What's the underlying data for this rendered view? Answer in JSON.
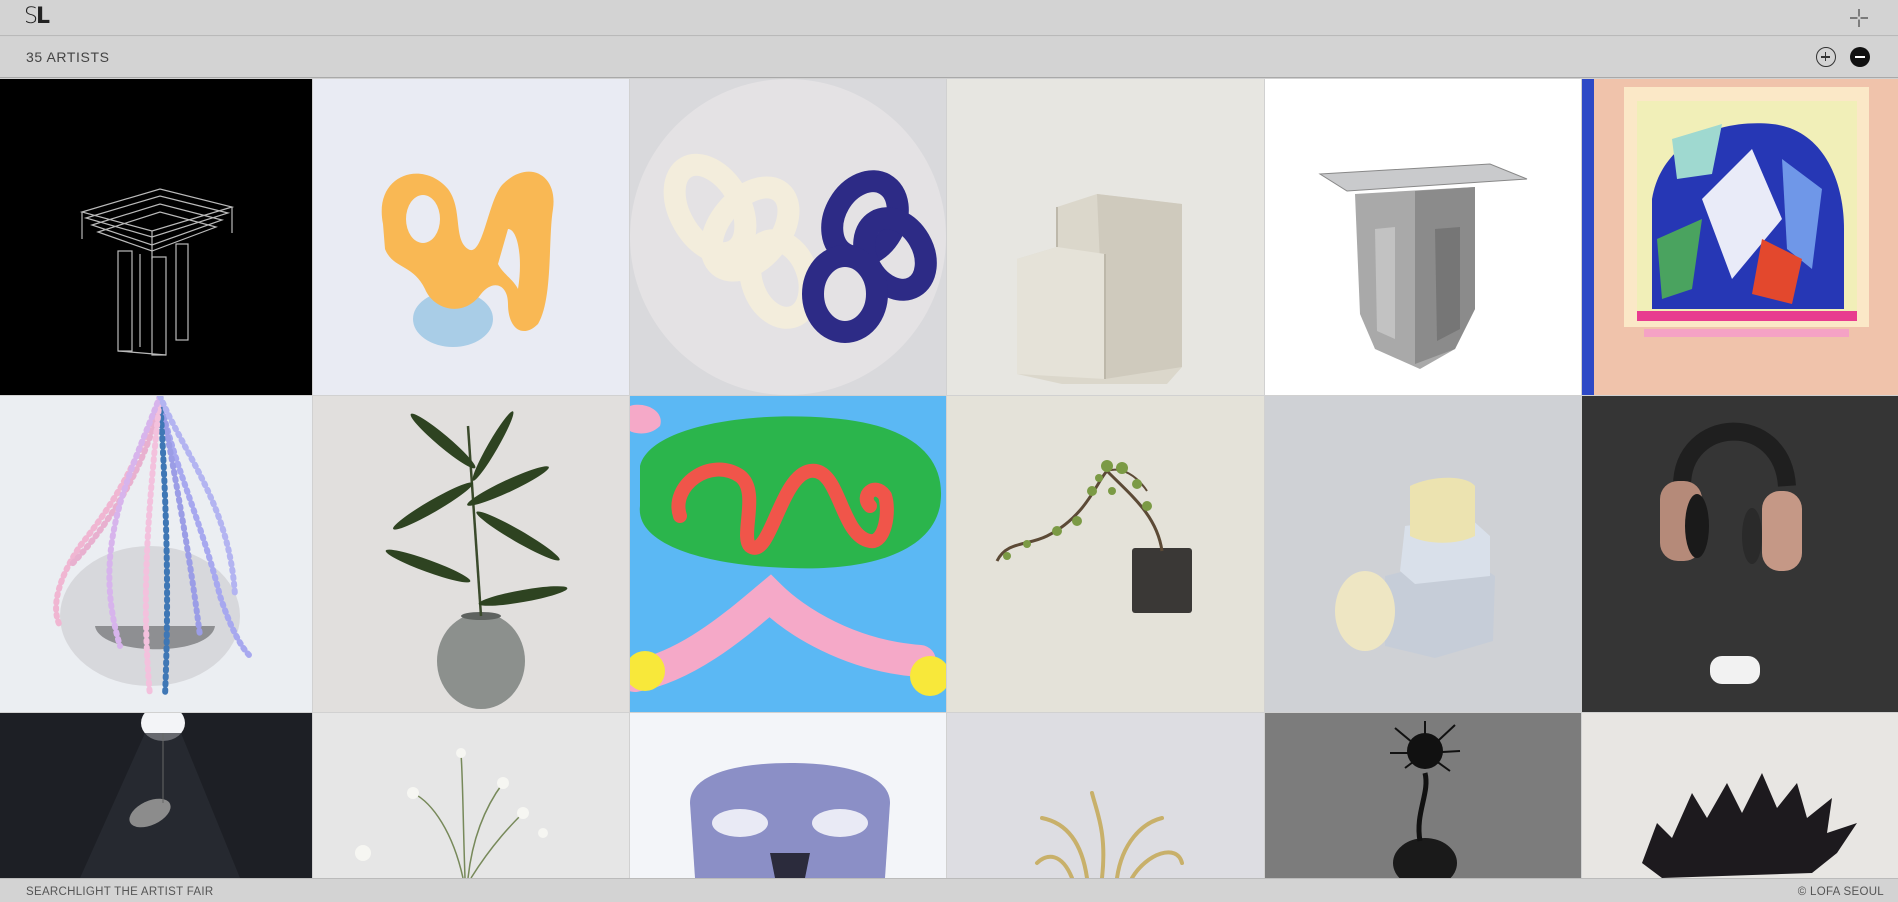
{
  "header": {
    "logo_s": "S",
    "logo_l": "L",
    "menu_icon": "plus-crosshair-icon"
  },
  "toolbar": {
    "artist_count": "35 ARTISTS",
    "zoom_in_icon": "plus-circle-icon",
    "zoom_out_icon": "minus-circle-icon"
  },
  "artworks": [
    {
      "subject": "clear acrylic stacked table sculpture on black",
      "bg": "#000000"
    },
    {
      "subject": "orange looped sculpture on blue stone",
      "bg": "#e9ebf3"
    },
    {
      "subject": "white and blue twisted ceramic knots",
      "bg": "#d9d9dc"
    },
    {
      "subject": "white plaster architectural block",
      "bg": "#e7e6e1"
    },
    {
      "subject": "aluminium side table with glass top",
      "bg": "#ffffff"
    },
    {
      "subject": "abstract blue and pink painting",
      "bg": "#f0c3ab"
    },
    {
      "subject": "beaded hanging sculpture over stone",
      "bg": "#ebeef2"
    },
    {
      "subject": "bamboo branch in grey vase",
      "bg": "#e1dfdd"
    },
    {
      "subject": "colourful digital drawing with green blob",
      "bg": "#5bb8f4"
    },
    {
      "subject": "bonsai branch in dark square pot",
      "bg": "#e4e2d9"
    },
    {
      "subject": "stacked paper and clay vessels",
      "bg": "#cfd1d5"
    },
    {
      "subject": "headphones and earbuds case sculpture",
      "bg": "#353535"
    },
    {
      "subject": "figure suspended under spotlight",
      "bg": "#1d1f25"
    },
    {
      "subject": "wild white flowers",
      "bg": "#e6e6e6"
    },
    {
      "subject": "lavender chair form",
      "bg": "#f3f5f9"
    },
    {
      "subject": "golden branching sculpture",
      "bg": "#dddde2"
    },
    {
      "subject": "black feathered form on vase",
      "bg": "#727272"
    },
    {
      "subject": "black spiky ceramic hedgehog",
      "bg": "#e8e6e3"
    }
  ],
  "footer": {
    "left": "SEARCHLIGHT THE ARTIST FAIR",
    "right": "© LOFA SEOUL"
  }
}
